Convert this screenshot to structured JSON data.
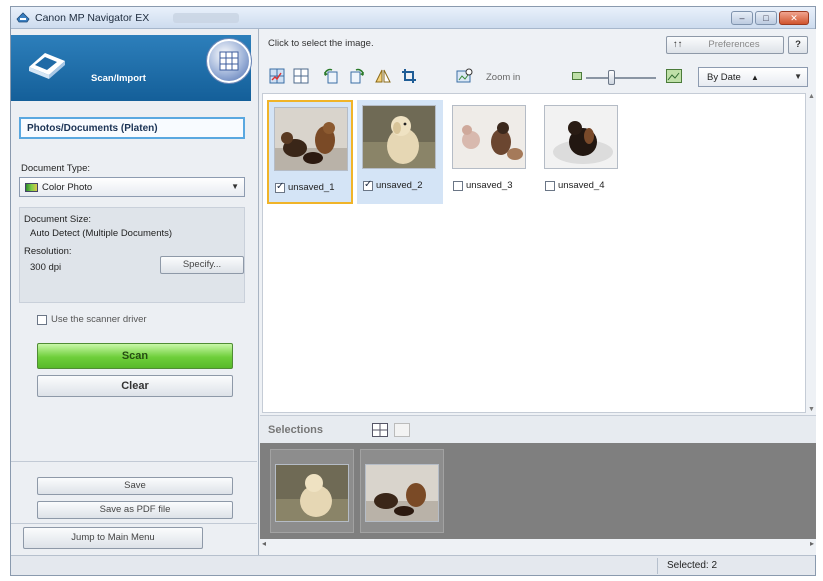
{
  "window": {
    "title": "Canon MP Navigator EX"
  },
  "window_controls": {
    "minimize": "–",
    "maximize": "□",
    "close": "✕"
  },
  "nav": {
    "scan_import_label": "Scan/Import"
  },
  "left": {
    "mode_label": "Photos/Documents (Platen)",
    "document_type_label": "Document Type:",
    "document_type_value": "Color Photo",
    "document_size_label": "Document Size:",
    "document_size_value": "Auto Detect (Multiple Documents)",
    "resolution_label": "Resolution:",
    "resolution_value": "300 dpi",
    "specify_button": "Specify...",
    "scanner_driver_label": "Use the scanner driver",
    "scanner_driver_checked": false,
    "scan_button": "Scan",
    "clear_button": "Clear",
    "save_button": "Save",
    "save_pdf_button": "Save as PDF file",
    "jump_button": "Jump to Main Menu"
  },
  "right": {
    "hint": "Click to select the image.",
    "preferences_button": "Preferences",
    "help_button": "?",
    "zoom_in": "Zoom in",
    "sort_value": "By Date",
    "sort_arrow": "▲",
    "zoom_level_fraction": 0.35,
    "selections_title": "Selections"
  },
  "thumbnails": [
    {
      "label": "unsaved_1",
      "checked": true
    },
    {
      "label": "unsaved_2",
      "checked": true
    },
    {
      "label": "unsaved_3",
      "checked": false
    },
    {
      "label": "unsaved_4",
      "checked": false
    }
  ],
  "icons": {
    "toolbar": [
      "select-all-icon",
      "grid-icon",
      "rotate-left-icon",
      "rotate-right-icon",
      "flip-icon",
      "crop-icon",
      "zoom-in-icon"
    ],
    "small_image": "small-image-icon",
    "large_image": "large-image-icon"
  },
  "status": {
    "selected": "Selected: 2"
  },
  "colors": {
    "accent": "#1b6fae",
    "scan_green": "#6ecf3a",
    "selection_border": "#f0b429"
  }
}
